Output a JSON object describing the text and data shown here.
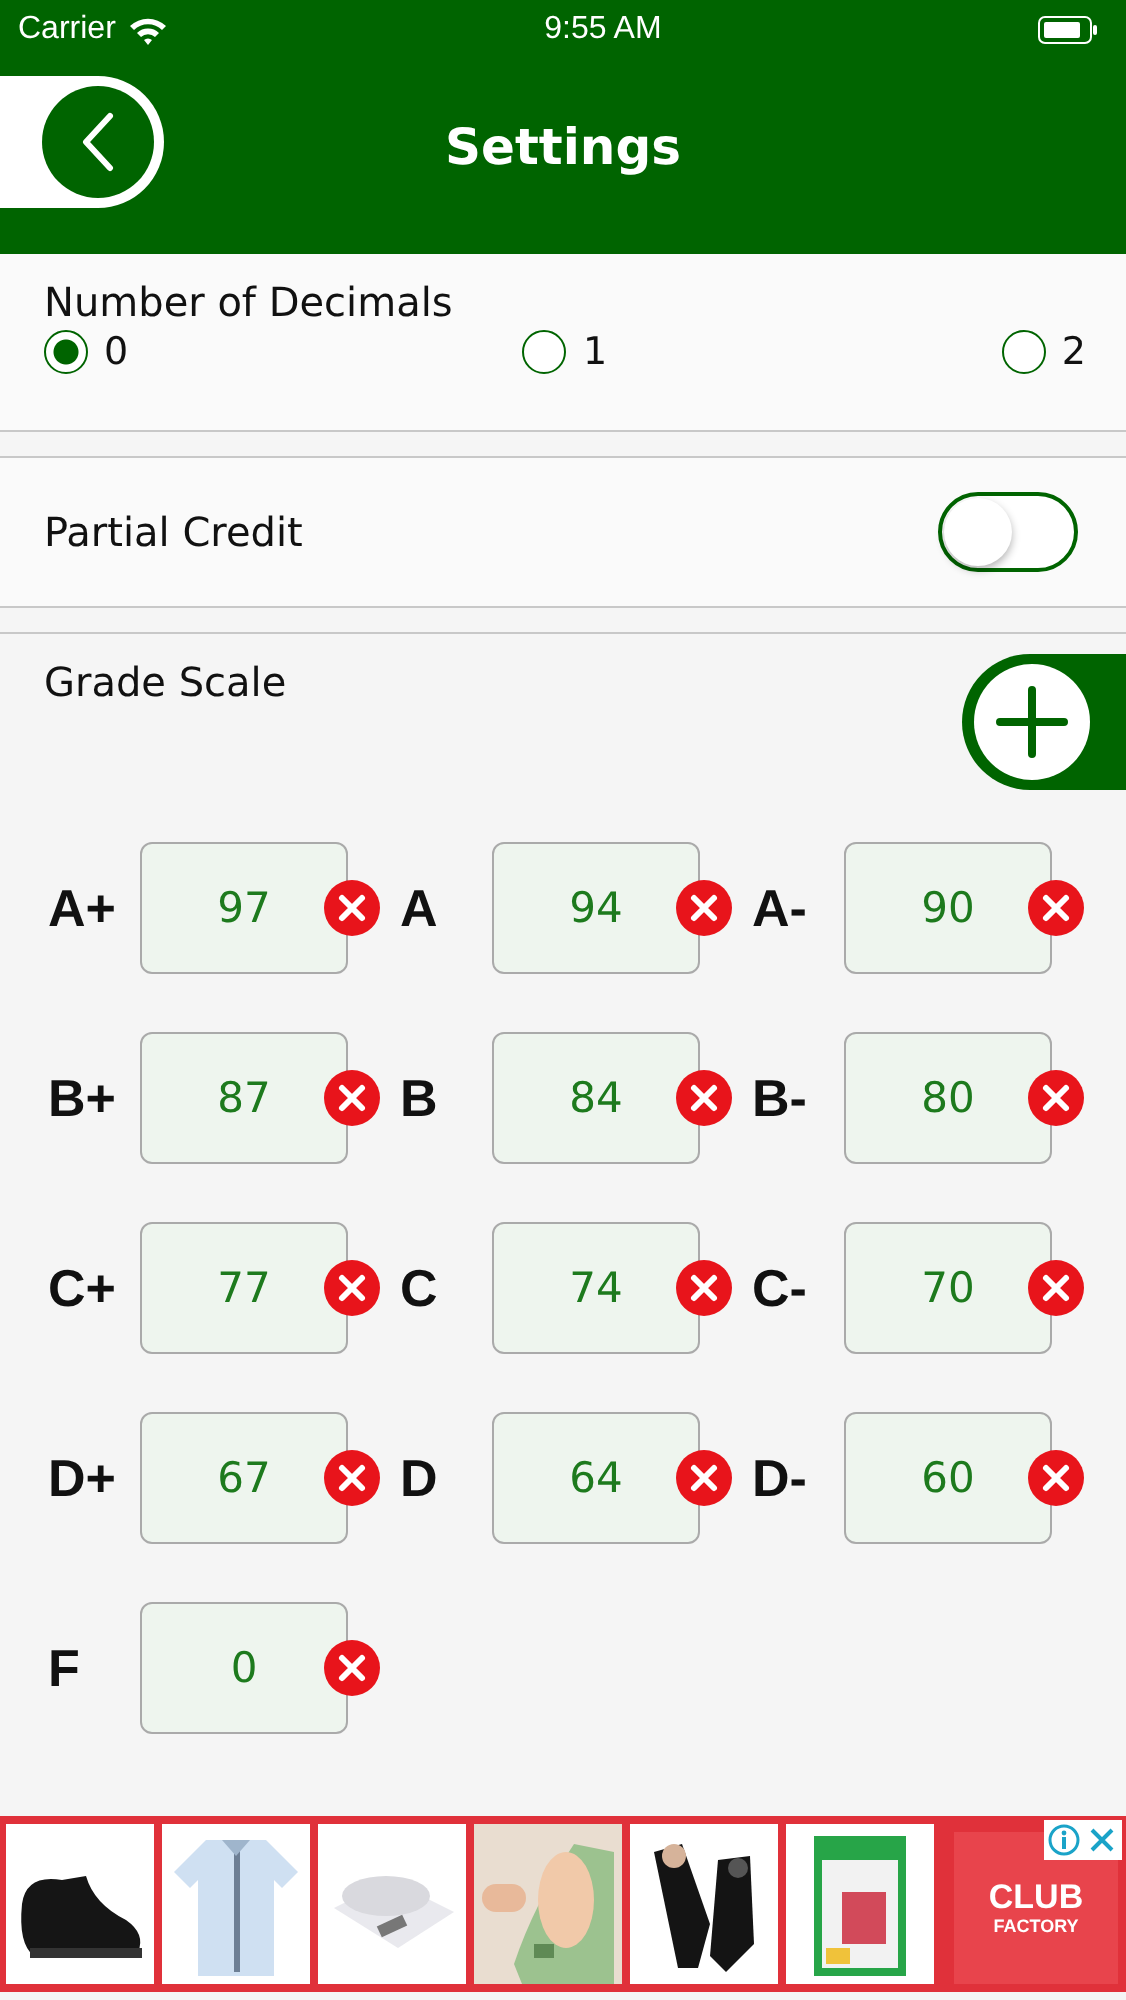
{
  "status_bar": {
    "carrier": "Carrier",
    "time": "9:55 AM"
  },
  "header": {
    "title": "Settings"
  },
  "decimals": {
    "label": "Number of Decimals",
    "options": [
      {
        "label": "0",
        "selected": true
      },
      {
        "label": "1",
        "selected": false
      },
      {
        "label": "2",
        "selected": false
      }
    ]
  },
  "partial_credit": {
    "label": "Partial Credit",
    "on": false
  },
  "grade_scale": {
    "title": "Grade Scale",
    "grades": [
      {
        "letter": "A+",
        "value": "97"
      },
      {
        "letter": "A",
        "value": "94"
      },
      {
        "letter": "A-",
        "value": "90"
      },
      {
        "letter": "B+",
        "value": "87"
      },
      {
        "letter": "B",
        "value": "84"
      },
      {
        "letter": "B-",
        "value": "80"
      },
      {
        "letter": "C+",
        "value": "77"
      },
      {
        "letter": "C",
        "value": "74"
      },
      {
        "letter": "C-",
        "value": "70"
      },
      {
        "letter": "D+",
        "value": "67"
      },
      {
        "letter": "D",
        "value": "64"
      },
      {
        "letter": "D-",
        "value": "60"
      },
      {
        "letter": "F",
        "value": "0"
      }
    ]
  },
  "ad": {
    "tiles": [
      {
        "kind": "picture"
      },
      {
        "kind": "picture"
      },
      {
        "kind": "picture"
      },
      {
        "kind": "picture"
      },
      {
        "kind": "picture"
      },
      {
        "kind": "picture"
      }
    ],
    "brand": [
      "CLUB",
      "FACTORY"
    ]
  }
}
